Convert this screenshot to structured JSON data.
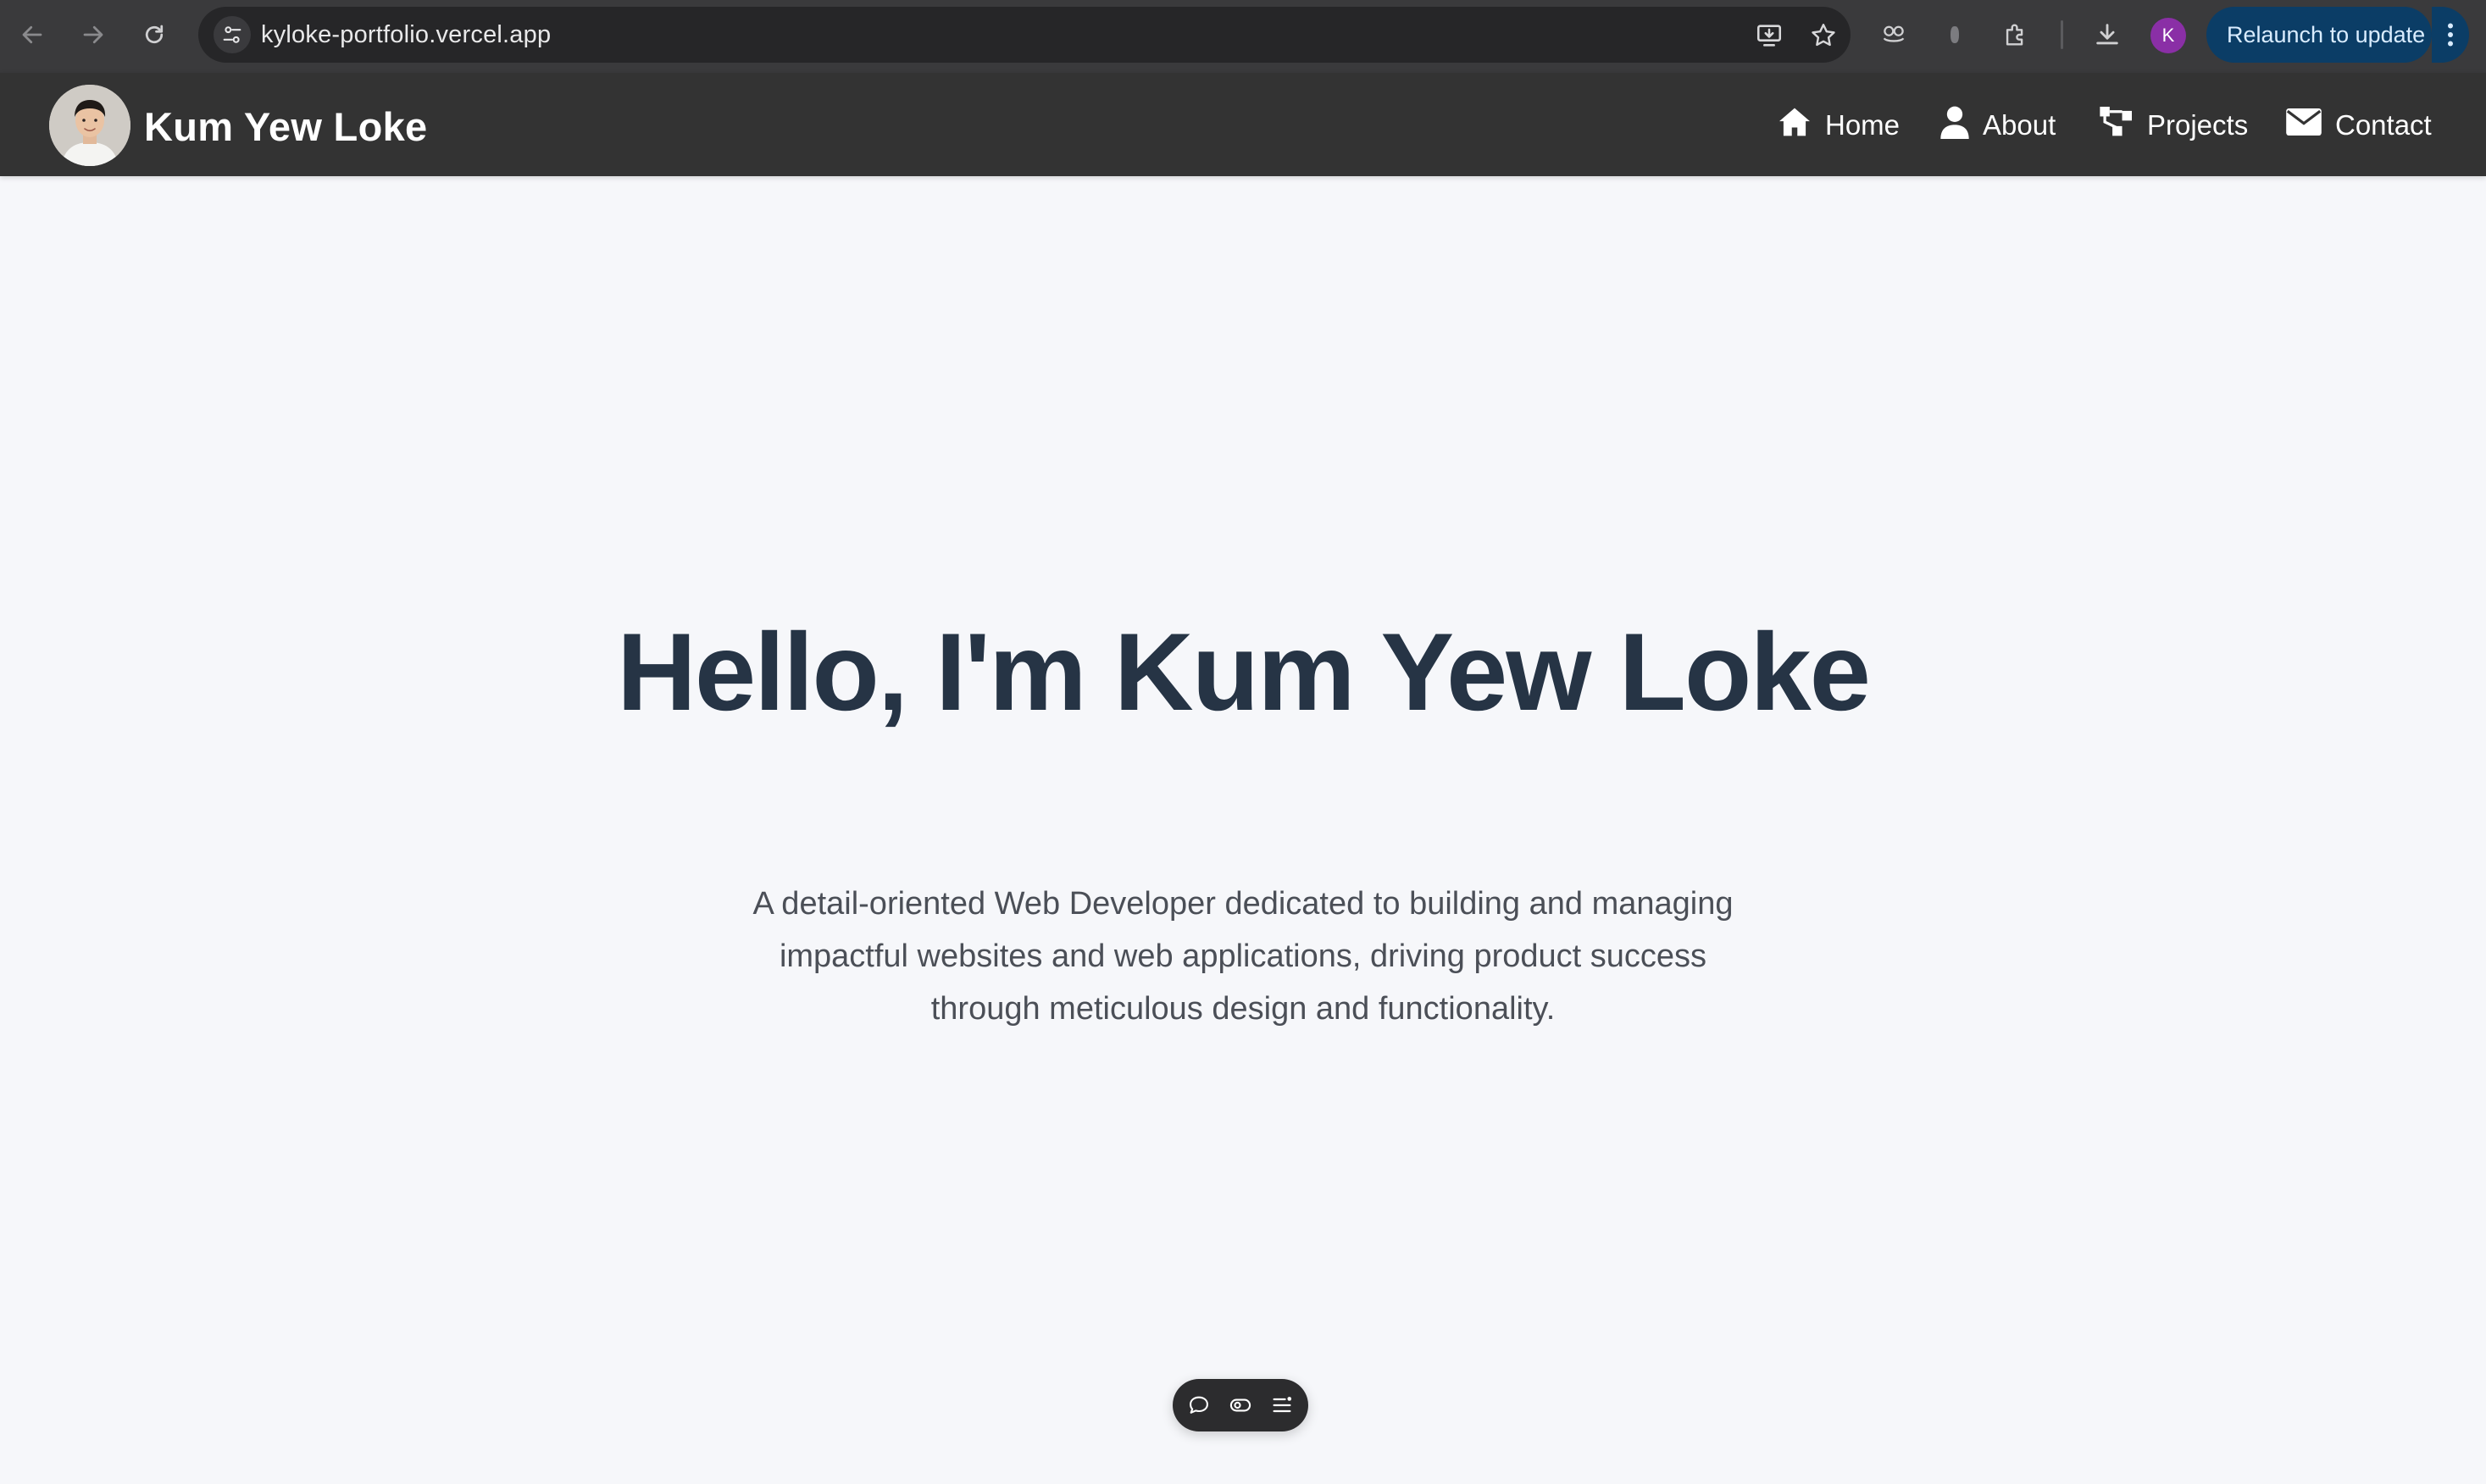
{
  "browser": {
    "url": "kyloke-portfolio.vercel.app",
    "profile_initial": "K",
    "relaunch_label": "Relaunch to update",
    "icons": [
      "back-icon",
      "forward-icon",
      "reload-icon",
      "site-settings-icon",
      "install-app-icon",
      "bookmark-star-icon",
      "extension-icon",
      "extension-icon",
      "puzzle-extensions-icon",
      "download-icon",
      "more-vertical-icon"
    ],
    "colors": {
      "relaunch_bg": "#0b3d66",
      "profile_bg": "#8a2fa6"
    }
  },
  "site": {
    "brand": "Kum Yew Loke",
    "nav": [
      {
        "label": "Home",
        "icon": "home-icon"
      },
      {
        "label": "About",
        "icon": "user-icon"
      },
      {
        "label": "Projects",
        "icon": "sitemap-icon"
      },
      {
        "label": "Contact",
        "icon": "envelope-icon"
      }
    ],
    "colors": {
      "header_bg": "#333333",
      "title": "#263445",
      "body_bg": "#f6f7fa"
    }
  },
  "hero": {
    "title": "Hello, I'm Kum Yew Loke",
    "description_lines": [
      "A detail-oriented Web Developer dedicated to building and managing",
      "impactful websites and web applications, driving product success",
      "through meticulous design and functionality."
    ]
  },
  "floating_toolbar": {
    "icons": [
      "comment-icon",
      "toggle-icon",
      "menu-list-icon"
    ]
  }
}
